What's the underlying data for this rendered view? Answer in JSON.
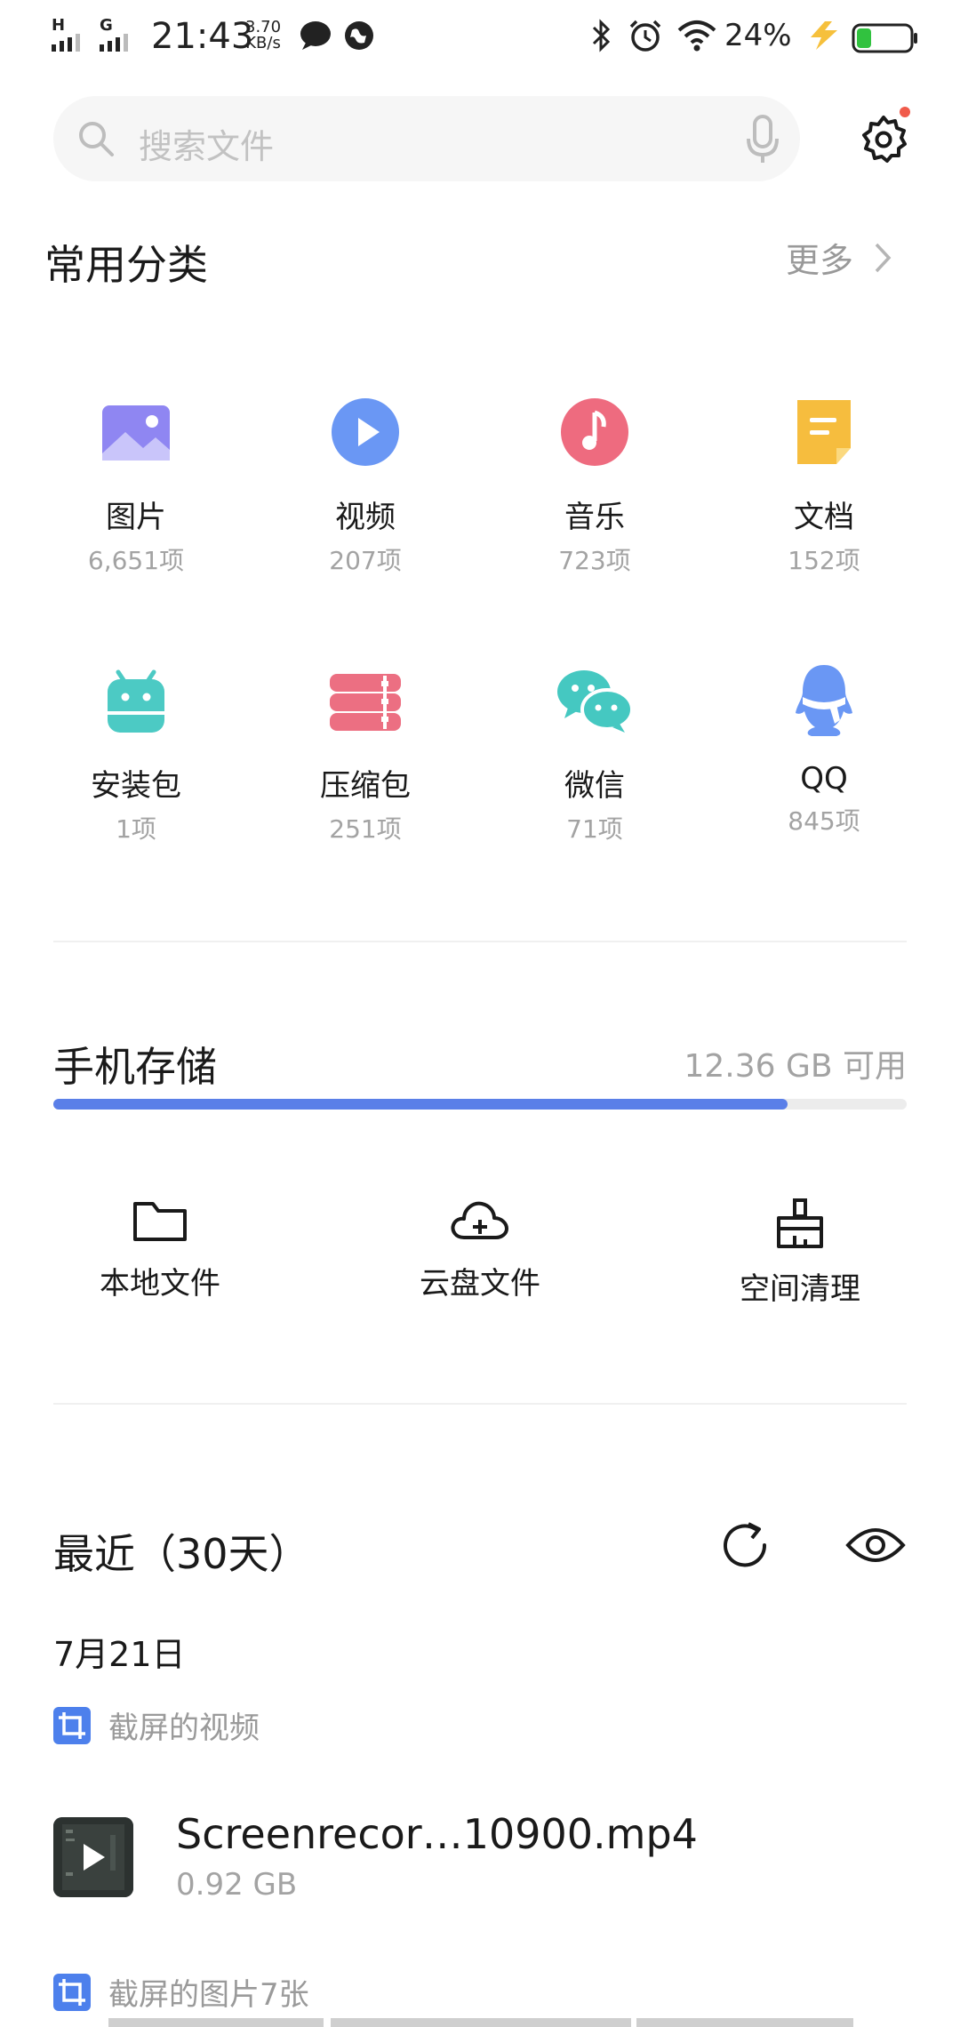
{
  "status_bar": {
    "signal1_tag": "H",
    "signal2_tag": "G",
    "time": "21:43",
    "speed_value": "3.70",
    "speed_unit": "KB/s",
    "battery_percent": "24%"
  },
  "search": {
    "placeholder": "搜索文件"
  },
  "categories": {
    "title": "常用分类",
    "more_label": "更多",
    "items": [
      {
        "label": "图片",
        "count": "6,651项",
        "icon": "image-icon",
        "color": "#8f86f2"
      },
      {
        "label": "视频",
        "count": "207项",
        "icon": "video-play-icon",
        "color": "#6a97f4"
      },
      {
        "label": "音乐",
        "count": "723项",
        "icon": "music-note-icon",
        "color": "#ee6b7f"
      },
      {
        "label": "文档",
        "count": "152项",
        "icon": "document-icon",
        "color": "#f6bd3e"
      },
      {
        "label": "安装包",
        "count": "1项",
        "icon": "android-icon",
        "color": "#4ccac4"
      },
      {
        "label": "压缩包",
        "count": "251项",
        "icon": "archive-icon",
        "color": "#ec6f82"
      },
      {
        "label": "微信",
        "count": "71项",
        "icon": "wechat-icon",
        "color": "#45c8c1"
      },
      {
        "label": "QQ",
        "count": "845项",
        "icon": "qq-penguin-icon",
        "color": "#6a97f4"
      }
    ]
  },
  "storage": {
    "title": "手机存储",
    "available": "12.36 GB 可用",
    "used_fraction": 0.86,
    "bar_color": "#5a7fe8",
    "tools": [
      {
        "label": "本地文件",
        "icon": "folder-icon"
      },
      {
        "label": "云盘文件",
        "icon": "cloud-add-icon"
      },
      {
        "label": "空间清理",
        "icon": "broom-icon"
      }
    ]
  },
  "recent": {
    "title": "最近（30天）",
    "date": "7月21日",
    "groups": [
      {
        "source": "截屏的视频",
        "files": [
          {
            "name": "Screenrecor…10900.mp4",
            "size": "0.92 GB"
          }
        ]
      },
      {
        "source": "截屏的图片7张"
      }
    ]
  }
}
